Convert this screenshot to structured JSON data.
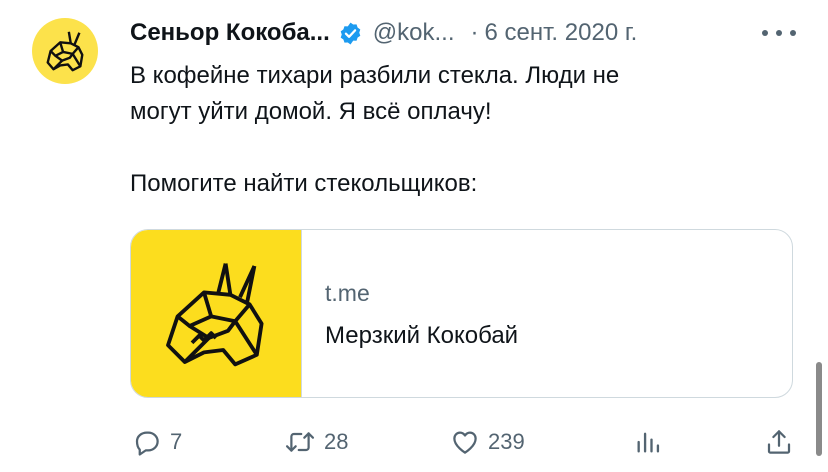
{
  "tweet": {
    "author": {
      "display_name": "Сеньор Кокоба...",
      "handle": "@kok...",
      "verified": true,
      "avatar_icon": "dog-head-logo-icon",
      "avatar_color": "#fce24b"
    },
    "separator": "·",
    "date": "6 сент. 2020 г.",
    "more_icon": "more-dots-icon",
    "text_line1": "В кофейне тихари разбили стекла. Люди не",
    "text_line2": "могут уйти домой. Я всё оплачу!",
    "text_line3": "Помогите найти стекольщиков:"
  },
  "card": {
    "domain": "t.me",
    "title": "Мерзкий Кокобай",
    "image_icon": "dog-head-logo-icon",
    "image_color": "#fcdd1e"
  },
  "actions": {
    "reply": {
      "icon": "reply-icon",
      "count": "7"
    },
    "retweet": {
      "icon": "retweet-icon",
      "count": "28"
    },
    "like": {
      "icon": "heart-icon",
      "count": "239"
    },
    "views": {
      "icon": "views-chart-icon"
    },
    "share": {
      "icon": "share-icon"
    }
  },
  "colors": {
    "text": "#0f1419",
    "secondary": "#536471",
    "verified_blue": "#1d9bf0",
    "border": "#cfd9de"
  }
}
